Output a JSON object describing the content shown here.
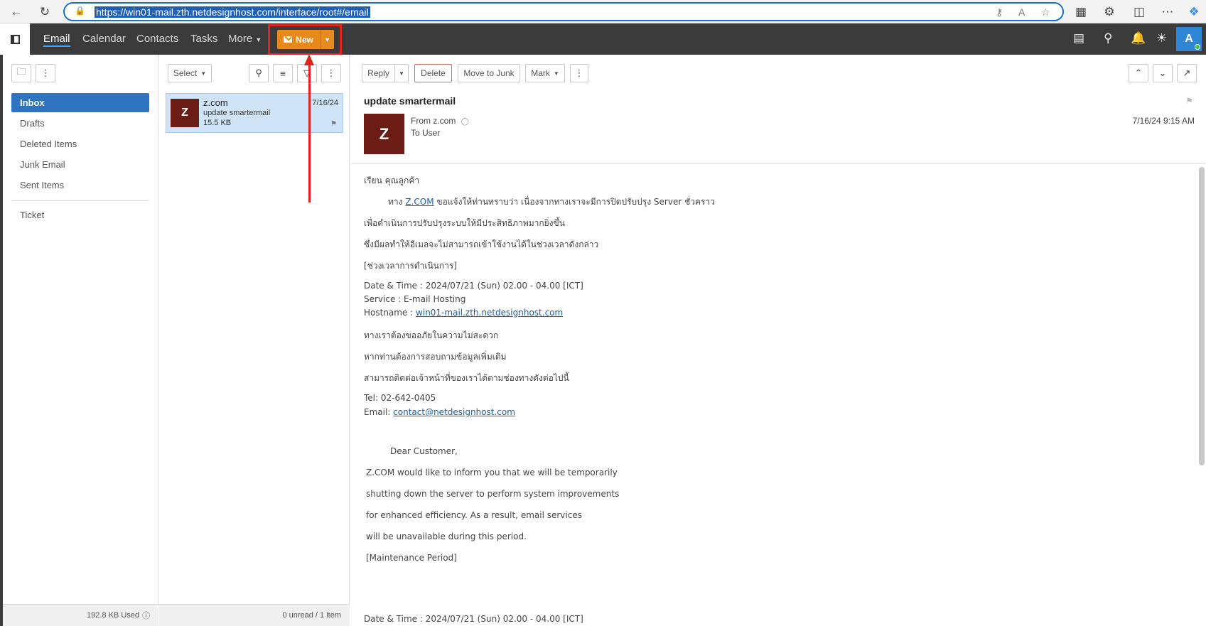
{
  "browser": {
    "url": "https://win01-mail.zth.netdesignhost.com/interface/root#/email",
    "icons": [
      "back-icon",
      "refresh-icon",
      "lock-icon",
      "key-icon",
      "read-aloud-icon",
      "favorite-icon",
      "translate-icon",
      "extensions-icon",
      "split-screen-icon",
      "more-icon",
      "copilot-icon"
    ]
  },
  "nav": {
    "items": [
      "Email",
      "Calendar",
      "Contacts",
      "Tasks",
      "More"
    ],
    "new_label": "New",
    "avatar": "A",
    "icons": [
      "chat-icon",
      "search-icon",
      "bell-icon",
      "theme-icon"
    ]
  },
  "folders": {
    "items": [
      "Inbox",
      "Drafts",
      "Deleted Items",
      "Junk Email",
      "Sent Items"
    ],
    "extra": "Ticket",
    "usage": "192.8 KB Used"
  },
  "list": {
    "select_label": "Select",
    "message": {
      "avatar": "Z",
      "from": "z.com",
      "subject": "update smartermail",
      "size": "15.5 KB",
      "date": "7/16/24"
    },
    "footer": "0 unread / 1 item"
  },
  "reader": {
    "toolbar": {
      "reply": "Reply",
      "delete": "Delete",
      "junk": "Move to Junk",
      "mark": "Mark"
    },
    "subject": "update smartermail",
    "avatar": "Z",
    "from": "From z.com",
    "to": "To User",
    "date": "7/16/24 9:15 AM",
    "body": {
      "l1": "เรียน คุณลูกค้า",
      "l2_pre": "ทาง",
      "l2_link": "Z.COM",
      "l2_post": "ขอแจ้งให้ท่านทราบว่า เนื่องจากทางเราจะมีการปิดปรับปรุง Server ชั่วคราว",
      "l3": "เพื่อดำเนินการปรับปรุงระบบให้มีประสิทธิภาพมากยิ่งขึ้น",
      "l4": "ซึ่งมีผลทำให้อีเมลจะไม่สามารถเข้าใช้งานได้ในช่วงเวลาดังกล่าว",
      "l5": "[ช่วงเวลาการดำเนินการ]",
      "l6": "Date & Time : 2024/07/21 (Sun) 02.00 - 04.00 [ICT]",
      "l7": "Service : E-mail Hosting",
      "l8_pre": "Hostname :",
      "l8_link": "win01-mail.zth.netdesignhost.com",
      "l9": "ทางเราต้องขออภัยในความไม่สะดวก",
      "l10": "หากท่านต้องการสอบถามข้อมูลเพิ่มเติม",
      "l11": "สามารถติดต่อเจ้าหน้าที่ของเราได้ตามช่องทางดังต่อไปนี้",
      "l12": "Tel: 02-642-0405",
      "l13_pre": "Email:",
      "l13_link": "contact@netdesignhost.com",
      "l14": "Dear Customer,",
      "l15": "Z.COM would like to inform you that we will be temporarily",
      "l16": "shutting down the server to perform system improvements",
      "l17": "for enhanced efficiency. As a result, email services",
      "l18": "will be unavailable during this period.",
      "l19": "[Maintenance Period]",
      "l20": "Date & Time : 2024/07/21 (Sun) 02.00 - 04.00 [ICT]"
    }
  },
  "colors": {
    "nav_bg": "#3b3b3b",
    "accent": "#2f74c0",
    "new_button": "#e8891d",
    "annotation": "#e0241f",
    "avatar_bg": "#6b1c15"
  }
}
